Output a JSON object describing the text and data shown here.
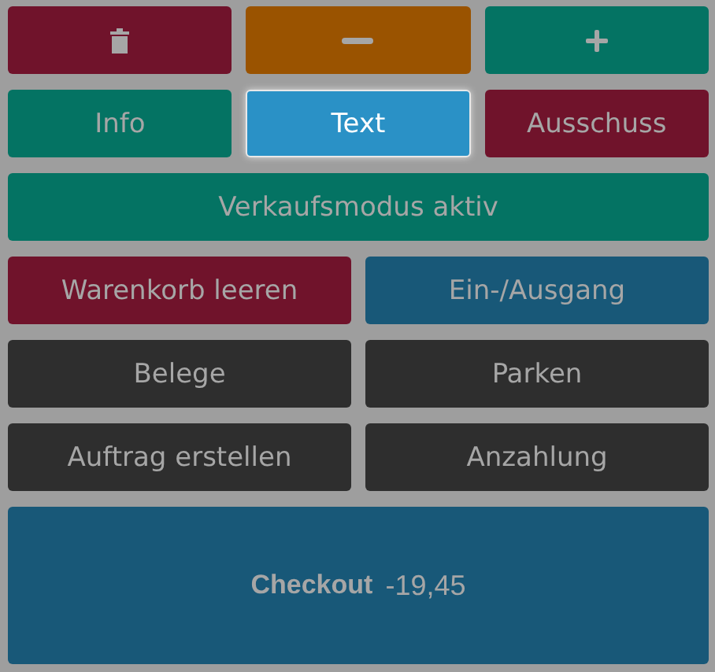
{
  "tool_buttons": [
    {
      "kind": "trash",
      "color": "#70132b"
    },
    {
      "kind": "minus",
      "color": "#9a5300"
    },
    {
      "kind": "plus",
      "color": "#047363"
    }
  ],
  "mode_buttons": [
    {
      "label": "Info",
      "selected": false,
      "color": "#047363"
    },
    {
      "label": "Text",
      "selected": true,
      "color": "#2a91c6"
    },
    {
      "label": "Ausschuss",
      "selected": false,
      "color": "#70132b"
    }
  ],
  "status_button": {
    "label": "Verkaufsmodus aktiv",
    "color": "#047363"
  },
  "action_buttons": [
    {
      "label": "Warenkorb leeren",
      "color": "#70132b"
    },
    {
      "label": "Ein-/Ausgang",
      "color": "#185878"
    },
    {
      "label": "Belege",
      "color": "#2e2e2e"
    },
    {
      "label": "Parken",
      "color": "#2e2e2e"
    },
    {
      "label": "Auftrag erstellen",
      "color": "#2e2e2e"
    },
    {
      "label": "Anzahlung",
      "color": "#2e2e2e"
    }
  ],
  "checkout": {
    "label": "Checkout",
    "amount": "-19,45",
    "color": "#185878"
  }
}
